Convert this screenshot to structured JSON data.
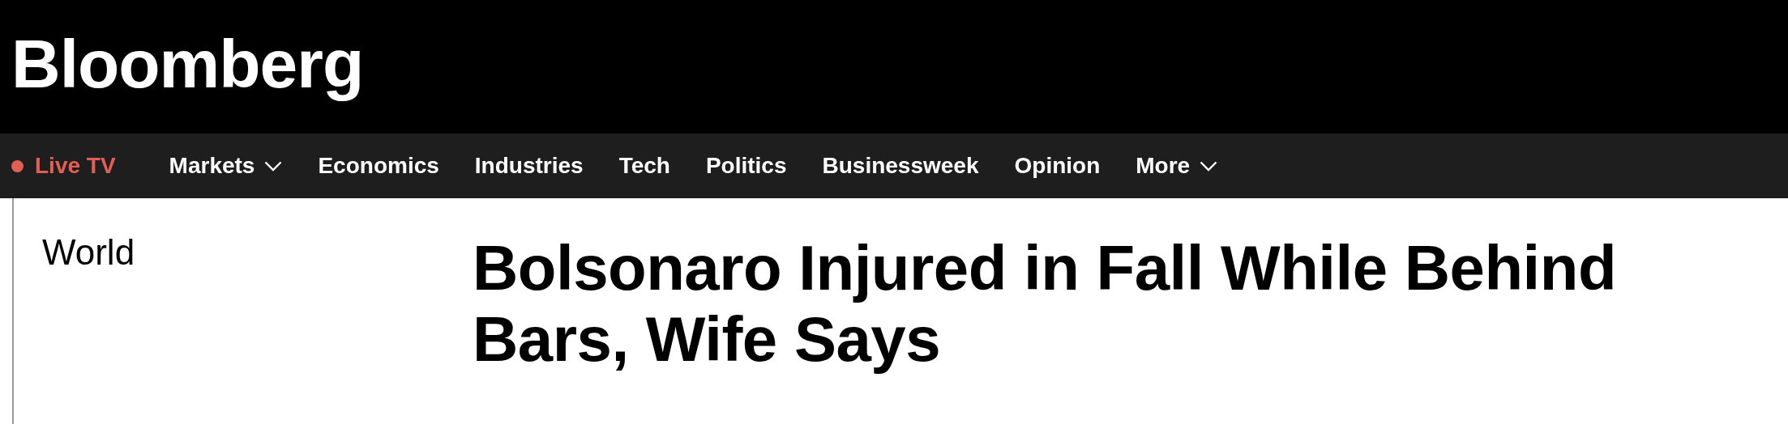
{
  "header": {
    "logo": "Bloomberg"
  },
  "nav": {
    "items": [
      {
        "label": "Live TV",
        "kind": "live"
      },
      {
        "label": "Markets",
        "kind": "dropdown"
      },
      {
        "label": "Economics",
        "kind": "link"
      },
      {
        "label": "Industries",
        "kind": "link"
      },
      {
        "label": "Tech",
        "kind": "link"
      },
      {
        "label": "Politics",
        "kind": "link"
      },
      {
        "label": "Businessweek",
        "kind": "link"
      },
      {
        "label": "Opinion",
        "kind": "link"
      },
      {
        "label": "More",
        "kind": "dropdown"
      }
    ]
  },
  "article": {
    "section": "World",
    "headline": "Bolsonaro Injured in Fall While Behind Bars, Wife Says"
  }
}
